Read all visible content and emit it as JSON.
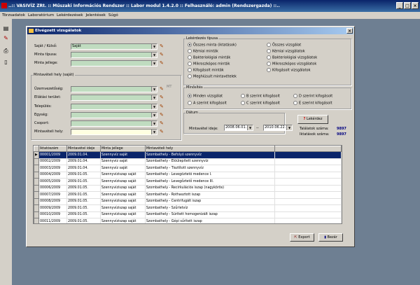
{
  "window": {
    "title": "..:: VASIVÍZ ZRt. :: Műszaki Információs Rendszer :: Labor modul 1.4.2.0 :: Felhasználó: admin (Rendszergazda) ::.."
  },
  "menu": [
    "Törzsadatok",
    "Laboratórium",
    "Lekérdezések",
    "Jelentések",
    "Súgó"
  ],
  "toolbar": {
    "icons": [
      "document-icon",
      "edit-icon",
      "print-icon",
      "page-icon"
    ]
  },
  "dialog": {
    "title": "Elvégzett vizsgálatok",
    "top_fields": [
      {
        "label": "Saját / Külső:",
        "value": "Saját"
      },
      {
        "label": "Minta típusa:",
        "value": ""
      },
      {
        "label": "Minta jellege:",
        "value": ""
      }
    ],
    "site_group": {
      "legend": "Mintavételi hely (saját)",
      "fields": [
        {
          "label": "Üzemvezetőség:",
          "value": ""
        },
        {
          "label": "Ellátási terület:",
          "value": ""
        },
        {
          "label": "Település:",
          "value": ""
        },
        {
          "label": "Egység:",
          "value": ""
        },
        {
          "label": "Csoport:",
          "value": ""
        },
        {
          "label": "Mintavételi hely:",
          "value": ""
        }
      ],
      "mt_label": "MT"
    },
    "query_type": {
      "legend": "Lekérdezés típusa",
      "options": [
        {
          "label": "Összes minta (iktatások)",
          "checked": true
        },
        {
          "label": "Összes vizsgálat",
          "checked": false
        },
        {
          "label": "Kémiai minták",
          "checked": false
        },
        {
          "label": "Kémiai vizsgálatok",
          "checked": false
        },
        {
          "label": "Bakteriológiai minták",
          "checked": false
        },
        {
          "label": "Bakteriológiai vizsgálatok",
          "checked": false
        },
        {
          "label": "Mikroszkópos minták",
          "checked": false
        },
        {
          "label": "Mikroszkópos vizsgálatok",
          "checked": false
        },
        {
          "label": "Kifogásolt minták",
          "checked": false
        },
        {
          "label": "Kifogásolt vizsgálatok",
          "checked": false
        },
        {
          "label": "Meghiúsult mintavételek",
          "checked": false
        }
      ]
    },
    "rating": {
      "legend": "Minősítés",
      "options": [
        {
          "label": "Minden vizsgálat",
          "checked": true
        },
        {
          "label": "B szerint kifogásolt",
          "checked": false
        },
        {
          "label": "D szerint kifogásolt",
          "checked": false
        },
        {
          "label": "A szerint kifogásolt",
          "checked": false
        },
        {
          "label": "C szerint kifogásolt",
          "checked": false
        },
        {
          "label": "E szerint kifogásolt",
          "checked": false
        }
      ]
    },
    "date": {
      "legend": "Dátum",
      "label": "Mintavétel ideje:",
      "from": "2008.06.01.",
      "separator": "--",
      "to": "2010.06.22."
    },
    "query_button": "Lekérdez",
    "stats": [
      {
        "label": "Találatok száma:",
        "value": "9897"
      },
      {
        "label": "Iktatások száma:",
        "value": "9897"
      }
    ],
    "table": {
      "columns": [
        "Iktatószám",
        "Mintavétel ideje",
        "Minta jellege",
        "Mintavételi hely"
      ],
      "rows": [
        [
          "00001/2009",
          "2009.01.04.",
          "Szennyvíz saját",
          "Szombathely - Befolyó szennyvíz"
        ],
        [
          "00002/2009",
          "2009.01.04.",
          "Szennyvíz saját",
          "Szombathely - Előülepített szennyvíz"
        ],
        [
          "00003/2009",
          "2009.01.04.",
          "Szennyvíz saját",
          "Szombathely - Tisztított szennyvíz"
        ],
        [
          "00004/2009",
          "2009.01.05.",
          "Szennyvíziszap saját",
          "Szombathely - Levegőztető medence I."
        ],
        [
          "00005/2009",
          "2009.01.05.",
          "Szennyvíziszap saját",
          "Szombathely - Levegőztető medence III."
        ],
        [
          "00006/2009",
          "2009.01.05.",
          "Szennyvíziszap saját",
          "Szombathely - Recirkulációs iszap (nagykörös)"
        ],
        [
          "00007/2009",
          "2009.01.05.",
          "Szennyvíziszap saját",
          "Szombathely - Rothasztott iszap"
        ],
        [
          "00008/2009",
          "2009.01.05.",
          "Szennyvíziszap saját",
          "Szombathely - Centrifugált iszap"
        ],
        [
          "00009/2009",
          "2009.01.05.",
          "Szennyvíziszap saját",
          "Szombathely - Szűrletvíz"
        ],
        [
          "00010/2009",
          "2009.01.05.",
          "Szennyvíziszap saját",
          "Szombathely - Sűrített homogenizált iszap"
        ],
        [
          "00011/2009",
          "2009.01.05.",
          "Szennyvíziszap saját",
          "Szombathely - Gépi sűrített iszap"
        ]
      ]
    },
    "export_button": "Export",
    "close_button": "Bezár"
  }
}
